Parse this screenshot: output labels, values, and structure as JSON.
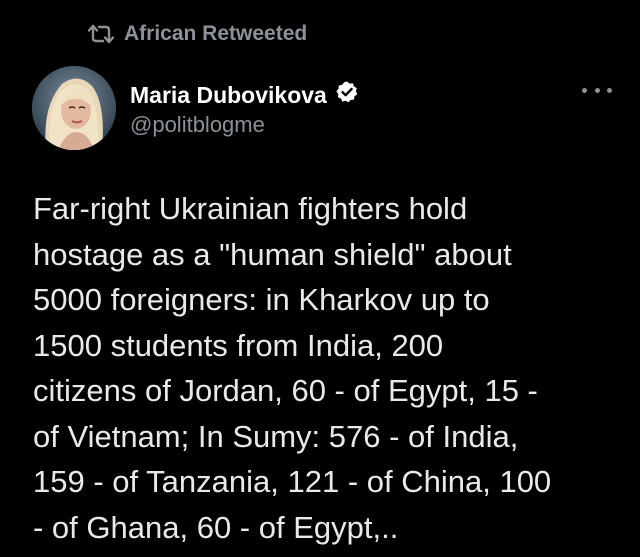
{
  "retweet": {
    "icon": "retweet-icon",
    "label": "African Retweeted"
  },
  "author": {
    "name": "Maria Dubovikova",
    "verified_icon": "verified-badge-icon",
    "handle": "@politblogme",
    "avatar_icon": "avatar"
  },
  "more_icon": "more-options-icon",
  "tweet": {
    "text": "Far-right Ukrainian fighters hold\nhostage as a \"human shield\" about\n5000 foreigners: in Kharkov up to\n1500 students from India, 200\ncitizens of Jordan, 60 - of Egypt, 15 -\nof Vietnam; In Sumy: 576 - of India,\n159 - of Tanzania, 121 - of China, 100\n- of Ghana, 60 - of Egypt,.."
  },
  "colors": {
    "background": "#000000",
    "text": "#e7e9ea",
    "muted": "#8b9197",
    "name": "#ffffff"
  }
}
